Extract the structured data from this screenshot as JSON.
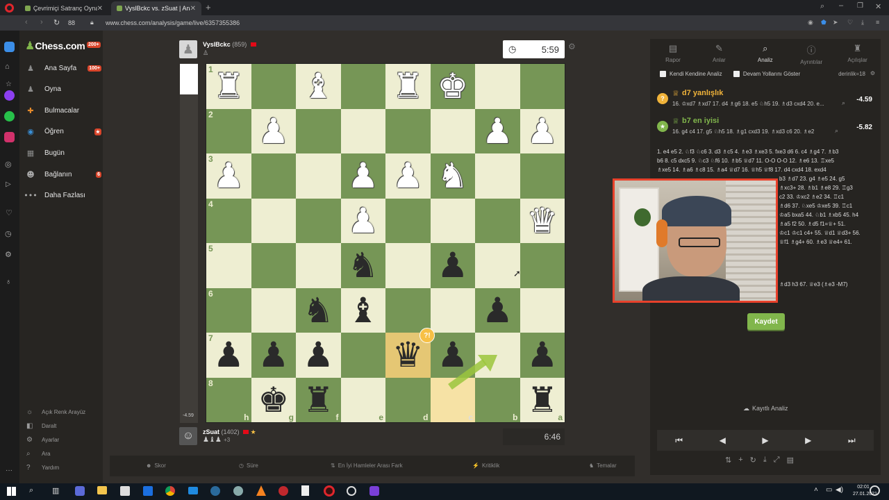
{
  "browser": {
    "tabs": [
      {
        "label": "Çevrimiçi Satranç Oyna - Ch",
        "active": false
      },
      {
        "label": "VyslBckc vs. zSuat | Analysi",
        "active": true
      }
    ],
    "tab_count": "88",
    "url": "www.chess.com/analysis/game/live/6357355386"
  },
  "sidebar": {
    "logo": "Chess.com",
    "logo_badge": "200+",
    "items": [
      {
        "label": "Ana Sayfa",
        "badge": "100+",
        "icon": "pawn-home-icon",
        "color": "#8a8a8a"
      },
      {
        "label": "Oyna",
        "badge": "",
        "icon": "pawn-play-icon",
        "color": "#8a8a8a"
      },
      {
        "label": "Bulmacalar",
        "badge": "",
        "icon": "puzzle-icon",
        "color": "#e58a2b"
      },
      {
        "label": "Öğren",
        "badge": "★",
        "icon": "learn-icon",
        "color": "#3a8fd6"
      },
      {
        "label": "Bugün",
        "badge": "",
        "icon": "today-icon",
        "color": "#8a8a8a"
      },
      {
        "label": "Bağlanın",
        "badge": "6",
        "icon": "connect-icon",
        "color": "#aaa"
      },
      {
        "label": "Daha Fazlası",
        "badge": "",
        "icon": "more-icon",
        "color": "#aaa"
      }
    ],
    "bottom": [
      {
        "label": "Açık Renk Arayüz",
        "icon": "theme-icon"
      },
      {
        "label": "Daralt",
        "icon": "collapse-icon"
      },
      {
        "label": "Ayarlar",
        "icon": "settings-gear-icon"
      },
      {
        "label": "Ara",
        "icon": "search-icon"
      },
      {
        "label": "Yardım",
        "icon": "help-icon"
      }
    ]
  },
  "top_player": {
    "name": "VyslBckc",
    "rating": "(859)",
    "clock": "5:59"
  },
  "bottom_player": {
    "name": "zSuat",
    "rating": "(1402)",
    "clock": "6:46",
    "captured": "+3"
  },
  "eval_label": "-4.59",
  "board": {
    "ranks": [
      "1",
      "2",
      "3",
      "4",
      "5",
      "6",
      "7",
      "8"
    ],
    "files": [
      "h",
      "g",
      "f",
      "e",
      "d",
      "c",
      "b",
      "a"
    ],
    "rows": [
      [
        "wR",
        "",
        "wB",
        "",
        "wR",
        "wK",
        "",
        ""
      ],
      [
        "",
        "wP",
        "",
        "",
        "",
        "",
        "wP",
        "wP"
      ],
      [
        "wP",
        "",
        "",
        "wP",
        "wP",
        "wN",
        "",
        ""
      ],
      [
        "",
        "",
        "",
        "wP",
        "",
        "",
        "",
        "wQ"
      ],
      [
        "",
        "",
        "",
        "bN",
        "",
        "bP",
        "",
        ""
      ],
      [
        "",
        "",
        "bN",
        "bB",
        "",
        "",
        "bP",
        ""
      ],
      [
        "bP",
        "bP",
        "bP",
        "",
        "bQ",
        "bP",
        "",
        "bP"
      ],
      [
        "",
        "bK",
        "bR",
        "",
        "",
        "",
        "",
        "bR"
      ]
    ],
    "highlight": [
      "6-4",
      "7-5"
    ],
    "annotation_mark": "?!"
  },
  "right_panel": {
    "tabs": [
      {
        "label": "Rapor",
        "icon": "report-icon"
      },
      {
        "label": "Anlar",
        "icon": "moments-icon"
      },
      {
        "label": "Analiz",
        "icon": "analysis-search-icon"
      },
      {
        "label": "Ayrıntılar",
        "icon": "info-icon"
      },
      {
        "label": "Açılışlar",
        "icon": "openings-icon"
      }
    ],
    "own_analysis": "Kendi Kendine Analiz",
    "show_lines": "Devam Yollarını Göster",
    "depth": "derinlik=18",
    "mistake": {
      "title": "d7 yanlışlık",
      "line": "16. ♔xd7 ♗xd7 17. d4 ♗g6 18. e5 ♘h5 19. ♗d3 cxd4 20. e...",
      "eval": "-4.59"
    },
    "best": {
      "title": "b7 en iyisi",
      "line": "16. g4 c4 17. g5 ♘h5 18. ♗g1 cxd3 19. ♗xd3 c6 20. ♗e2",
      "eval": "-5.82"
    },
    "moves_lines": [
      "1. e4 e5 2. ♘f3 ♘c6 3. d3 ♗c5 4. ♗e3 ♗xe3 5. fxe3 d6 6. c4 ♗g4 7. ♗b3",
      "b6 8. c5 dxc5 9. ♘c3 ♘f6 10. ♗b5 ♕d7 11. O-O O-O 12. ♗e6 13. ♖xe5",
      "♗xe5 14. ♗a6 ♗c8 15. ♗a4 ♕d7 16. ♕h5 ♕f8 17. d4 cxd4 18. exd4",
      "b3 ♗d7 23. g4 ♗e5 24. g5",
      "♗xc3+ 28. ♗b1 ♗e8 29. ♖g3",
      "c2 33. ♔xc2 ♗e2 34. ♖c1",
      "♗d6 37. ♘xe5 ♔xe5 39. ♖c1",
      "♔a5 bxa5 44. ♘b1 ♗xb5 45. h4",
      "♗a5 f2 50. ♗d5 f1=♕+ 51.",
      "♔c1 ♔c1 c4+ 55. ♕d1 ♕d3+ 56.",
      "♕f1 ♗g4+ 60. ♗e3 ♕e4+ 61.",
      "♗d3 h3 67. ♕e3 (♗e3 -M7)"
    ],
    "save_button": "Kaydet",
    "saved_analysis": "Kayıtlı Analiz"
  },
  "bottom_bar": [
    {
      "label": "Skor",
      "icon": "score-icon"
    },
    {
      "label": "Süre",
      "icon": "clock-icon"
    },
    {
      "label": "En İyi Hamleler Arası Fark",
      "icon": "diff-icon"
    },
    {
      "label": "Kritiklik",
      "icon": "critical-icon"
    },
    {
      "label": "Temalar",
      "icon": "themes-icon"
    }
  ],
  "taskbar": {
    "time": "02:01",
    "date": "27.01.2021"
  }
}
